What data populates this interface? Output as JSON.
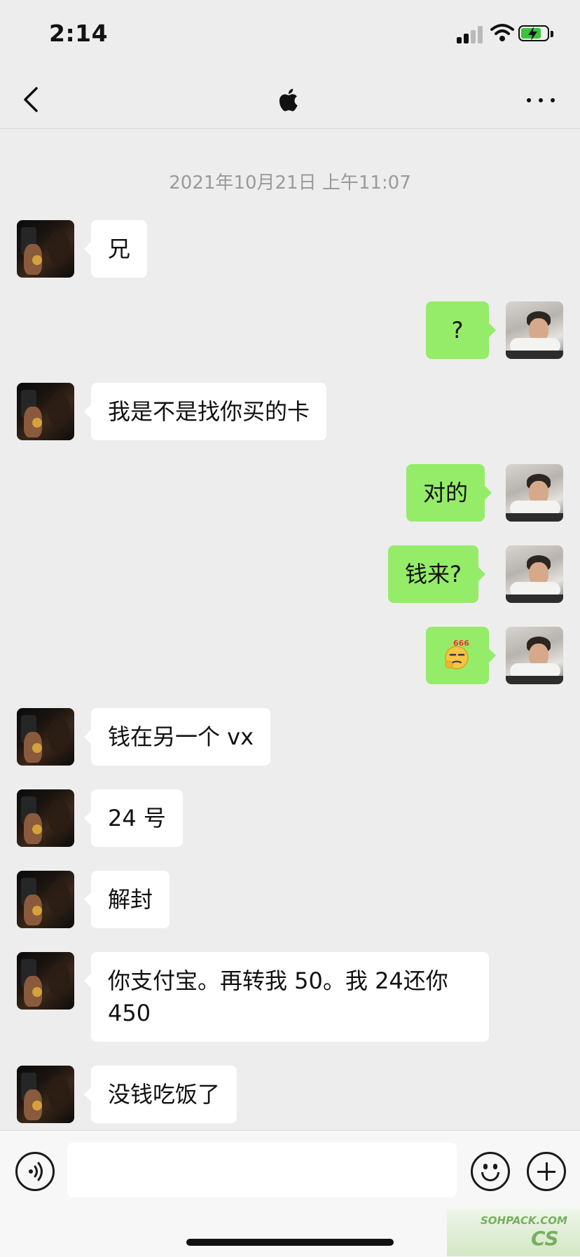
{
  "status_bar": {
    "time": "2:14"
  },
  "nav": {
    "title_icon": "apple-logo-icon",
    "back_icon": "chevron-left-icon",
    "more_icon": "more-dots-icon"
  },
  "chat": {
    "timestamp": "2021年10月21日 上午11:07",
    "messages": [
      {
        "side": "in",
        "text": "兄"
      },
      {
        "side": "out",
        "text": "?"
      },
      {
        "side": "in",
        "text": "我是不是找你买的卡"
      },
      {
        "side": "out",
        "text": "对的"
      },
      {
        "side": "out",
        "text": "钱来?"
      },
      {
        "side": "out",
        "sticker": "thinking-666-emoji",
        "sticker_text": "666"
      },
      {
        "side": "in",
        "text": "钱在另一个 vx"
      },
      {
        "side": "in",
        "text": "24 号"
      },
      {
        "side": "in",
        "text": "解封"
      },
      {
        "side": "in",
        "text": "你支付宝。再转我 50。我 24还你 450"
      },
      {
        "side": "in",
        "text": "没钱吃饭了"
      }
    ]
  },
  "input_bar": {
    "value": "",
    "placeholder": ""
  },
  "watermark": {
    "line1": "SOHPACK.COM",
    "line2": "CS"
  }
}
